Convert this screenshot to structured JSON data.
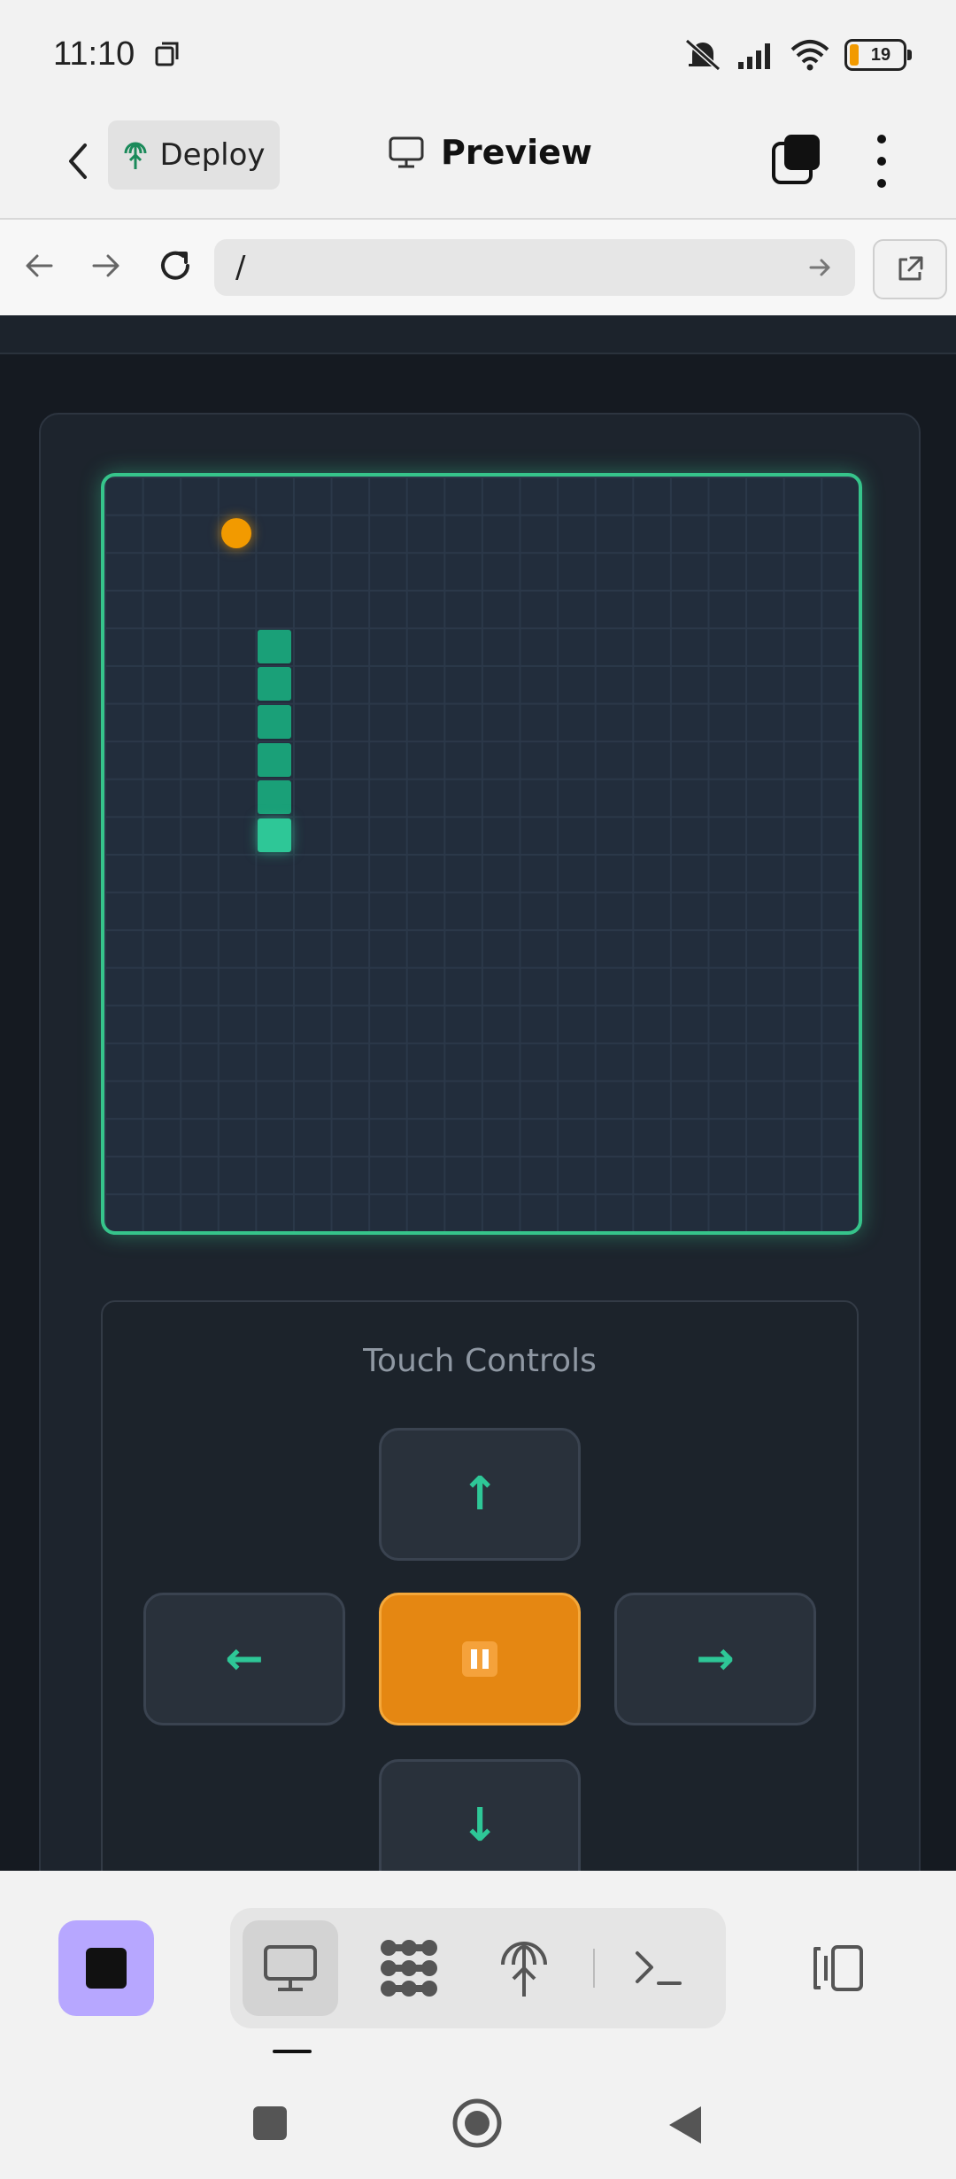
{
  "status_bar": {
    "time": "11:10",
    "battery": "19"
  },
  "header": {
    "deploy_label": "Deploy",
    "title": "Preview"
  },
  "url_bar": {
    "url": "/"
  },
  "game": {
    "controls_title": "Touch Controls",
    "buttons": {
      "up": "↑",
      "left": "←",
      "right": "→",
      "down": "↓"
    },
    "board_cols": 20,
    "food_cell": [
      3,
      1
    ],
    "snake_cells": [
      [
        4,
        4
      ],
      [
        4,
        5
      ],
      [
        4,
        6
      ],
      [
        4,
        7
      ],
      [
        4,
        8
      ],
      [
        4,
        9
      ]
    ],
    "colors": {
      "snake": "#1aa078",
      "head": "#2ec797",
      "food": "#f29a00",
      "board_border": "#36c48b"
    }
  },
  "toolbar": {
    "items": [
      "stop-icon",
      "monitor-icon",
      "apps-icon",
      "deploy-icon",
      "terminal-icon",
      "layout-icon"
    ],
    "accent": "#b7a7ff"
  }
}
